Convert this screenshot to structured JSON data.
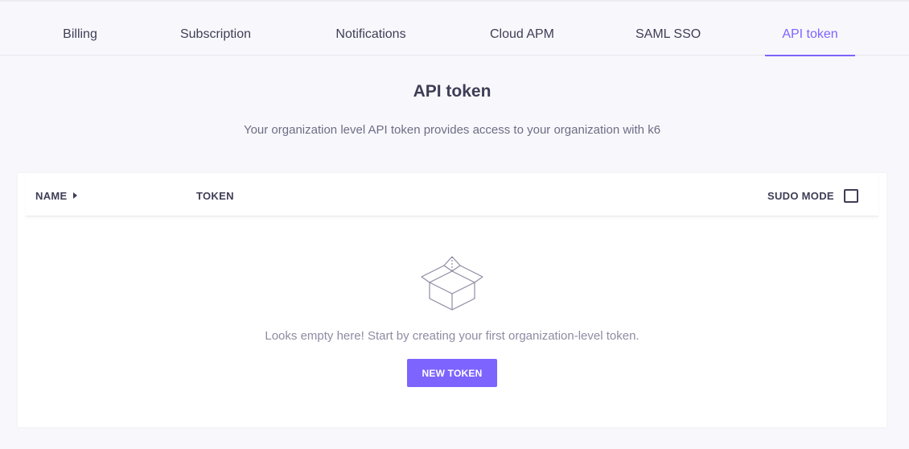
{
  "tabs": [
    {
      "label": "Billing"
    },
    {
      "label": "Subscription"
    },
    {
      "label": "Notifications"
    },
    {
      "label": "Cloud APM"
    },
    {
      "label": "SAML SSO"
    },
    {
      "label": "API token",
      "active": true
    }
  ],
  "page": {
    "title": "API token",
    "subtitle": "Your organization level API token provides access to your organization with k6"
  },
  "table": {
    "columns": {
      "name": "NAME",
      "token": "TOKEN",
      "sudo_mode": "SUDO MODE"
    },
    "sudo_mode_checked": false,
    "sort_icon": "caret-right-icon"
  },
  "empty_state": {
    "icon": "empty-box-icon",
    "message": "Looks empty here! Start by creating your first organization-level token.",
    "button_label": "NEW TOKEN"
  },
  "colors": {
    "accent": "#7d64ff",
    "text": "#3f3d56",
    "muted_text": "#8e8ca3",
    "background": "#f8f8fc"
  }
}
